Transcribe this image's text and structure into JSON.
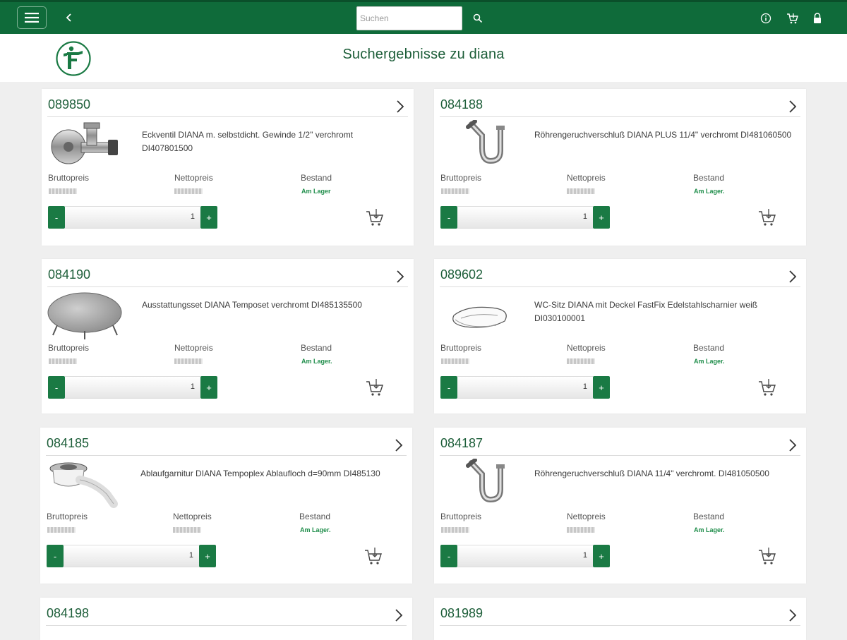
{
  "search": {
    "placeholder": "Suchen"
  },
  "header": {
    "title": "Suchergebnisse zu diana"
  },
  "colors": {
    "brand": "#0f6b3a",
    "accent": "#1d5e39",
    "stock": "#1e8d4a"
  },
  "labels": {
    "gross": "Bruttopreis",
    "net": "Nettopreis",
    "stock": "Bestand"
  },
  "products": [
    {
      "number": "089850",
      "desc": "Eckventil DIANA m. selbstdicht. Gewinde 1/2\" verchromt DI407801500",
      "stock": "Am Lager",
      "qty": "1",
      "image": "angle-valve"
    },
    {
      "number": "084188",
      "desc": "Röhrengeruchverschluß DIANA PLUS 11/4\" verchromt DI481060500",
      "stock": "Am Lager.",
      "qty": "1",
      "image": "pipe-trap"
    },
    {
      "number": "084190",
      "desc": "Ausstattungsset DIANA Temposet verchromt DI485135500",
      "stock": "Am Lager.",
      "qty": "1",
      "image": "drain-cover"
    },
    {
      "number": "089602",
      "desc": "WC-Sitz DIANA mit Deckel FastFix Edelstahlscharnier weiß DI030100001",
      "stock": "Am Lager.",
      "qty": "1",
      "image": "toilet-seat"
    },
    {
      "number": "084185",
      "desc": "Ablaufgarnitur DIANA Tempoplex Ablaufloch d=90mm DI485130",
      "stock": "Am Lager.",
      "qty": "1",
      "image": "drain-fitting"
    },
    {
      "number": "084187",
      "desc": "Röhrengeruchverschluß DIANA 11/4\" verchromt. DI481050500",
      "stock": "Am Lager.",
      "qty": "1",
      "image": "pipe-trap"
    },
    {
      "number": "084198",
      "desc": "",
      "stock": "",
      "qty": "",
      "image": ""
    },
    {
      "number": "081989",
      "desc": "",
      "stock": "",
      "qty": "",
      "image": ""
    }
  ]
}
